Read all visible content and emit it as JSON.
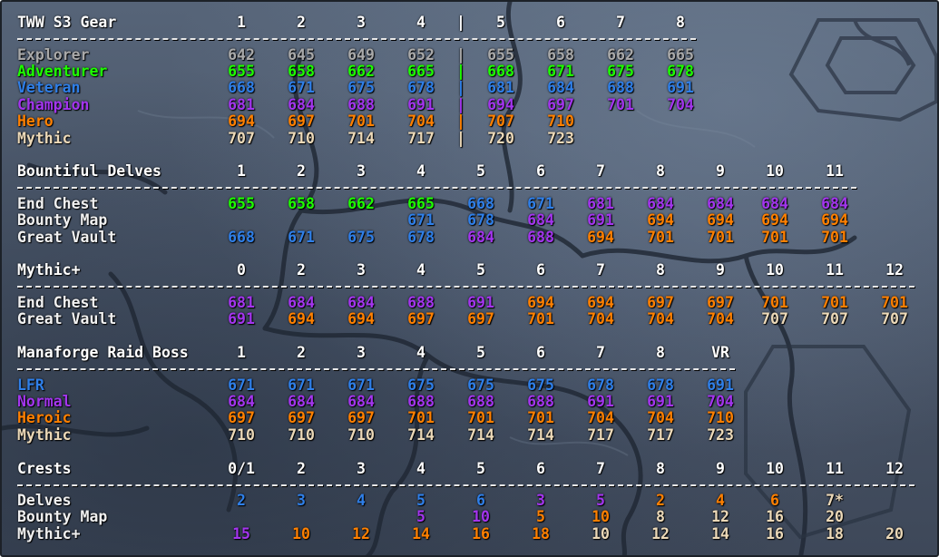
{
  "colors": {
    "explorer": "#a9a9a9",
    "adventurer": "#1eff00",
    "veteran": "#2f7fe8",
    "champion": "#a335ee",
    "hero": "#ff8000",
    "mythic": "#ecd9b8",
    "white": "#f0f0f0",
    "header": "#ffffff"
  },
  "sections": [
    {
      "id": "gear",
      "title": "TWW S3 Gear",
      "columns": [
        "1",
        "2",
        "3",
        "4",
        "|",
        "5",
        "6",
        "7",
        "8"
      ],
      "divider": "|",
      "rows": [
        {
          "label": "Explorer",
          "color": "explorer",
          "values": [
            "642",
            "645",
            "649",
            "652",
            "655",
            "658",
            "662",
            "665"
          ]
        },
        {
          "label": "Adventurer",
          "color": "adventurer",
          "values": [
            "655",
            "658",
            "662",
            "665",
            "668",
            "671",
            "675",
            "678"
          ]
        },
        {
          "label": "Veteran",
          "color": "veteran",
          "values": [
            "668",
            "671",
            "675",
            "678",
            "681",
            "684",
            "688",
            "691"
          ]
        },
        {
          "label": "Champion",
          "color": "champion",
          "values": [
            "681",
            "684",
            "688",
            "691",
            "694",
            "697",
            "701",
            "704"
          ]
        },
        {
          "label": "Hero",
          "color": "hero",
          "values": [
            "694",
            "697",
            "701",
            "704",
            "707",
            "710"
          ]
        },
        {
          "label": "Mythic",
          "color": "mythic",
          "values": [
            "707",
            "710",
            "714",
            "717",
            "720",
            "723"
          ]
        }
      ]
    },
    {
      "id": "delves",
      "title": "Bountiful Delves",
      "columns": [
        "1",
        "2",
        "3",
        "4",
        "5",
        "6",
        "7",
        "8",
        "9",
        "10",
        "11"
      ],
      "rows": [
        {
          "label": "End Chest",
          "cells": [
            {
              "v": "655",
              "c": "adventurer"
            },
            {
              "v": "658",
              "c": "adventurer"
            },
            {
              "v": "662",
              "c": "adventurer"
            },
            {
              "v": "665",
              "c": "adventurer"
            },
            {
              "v": "668",
              "c": "veteran"
            },
            {
              "v": "671",
              "c": "veteran"
            },
            {
              "v": "681",
              "c": "champion"
            },
            {
              "v": "684",
              "c": "champion"
            },
            {
              "v": "684",
              "c": "champion"
            },
            {
              "v": "684",
              "c": "champion"
            },
            {
              "v": "684",
              "c": "champion"
            }
          ]
        },
        {
          "label": "Bounty Map",
          "cells": [
            {
              "v": "",
              "c": "white"
            },
            {
              "v": "",
              "c": "white"
            },
            {
              "v": "",
              "c": "white"
            },
            {
              "v": "671",
              "c": "veteran"
            },
            {
              "v": "678",
              "c": "veteran"
            },
            {
              "v": "684",
              "c": "champion"
            },
            {
              "v": "691",
              "c": "champion"
            },
            {
              "v": "694",
              "c": "hero"
            },
            {
              "v": "694",
              "c": "hero"
            },
            {
              "v": "694",
              "c": "hero"
            },
            {
              "v": "694",
              "c": "hero"
            }
          ]
        },
        {
          "label": "Great Vault",
          "cells": [
            {
              "v": "668",
              "c": "veteran"
            },
            {
              "v": "671",
              "c": "veteran"
            },
            {
              "v": "675",
              "c": "veteran"
            },
            {
              "v": "678",
              "c": "veteran"
            },
            {
              "v": "684",
              "c": "champion"
            },
            {
              "v": "688",
              "c": "champion"
            },
            {
              "v": "694",
              "c": "hero"
            },
            {
              "v": "701",
              "c": "hero"
            },
            {
              "v": "701",
              "c": "hero"
            },
            {
              "v": "701",
              "c": "hero"
            },
            {
              "v": "701",
              "c": "hero"
            }
          ]
        }
      ]
    },
    {
      "id": "mythicplus",
      "title": "Mythic+",
      "columns": [
        "0",
        "2",
        "3",
        "4",
        "5",
        "6",
        "7",
        "8",
        "9",
        "10",
        "11",
        "12"
      ],
      "rows": [
        {
          "label": "End Chest",
          "cells": [
            {
              "v": "681",
              "c": "champion"
            },
            {
              "v": "684",
              "c": "champion"
            },
            {
              "v": "684",
              "c": "champion"
            },
            {
              "v": "688",
              "c": "champion"
            },
            {
              "v": "691",
              "c": "champion"
            },
            {
              "v": "694",
              "c": "hero"
            },
            {
              "v": "694",
              "c": "hero"
            },
            {
              "v": "697",
              "c": "hero"
            },
            {
              "v": "697",
              "c": "hero"
            },
            {
              "v": "701",
              "c": "hero"
            },
            {
              "v": "701",
              "c": "hero"
            },
            {
              "v": "701",
              "c": "hero"
            }
          ]
        },
        {
          "label": "Great Vault",
          "cells": [
            {
              "v": "691",
              "c": "champion"
            },
            {
              "v": "694",
              "c": "hero"
            },
            {
              "v": "694",
              "c": "hero"
            },
            {
              "v": "697",
              "c": "hero"
            },
            {
              "v": "697",
              "c": "hero"
            },
            {
              "v": "701",
              "c": "hero"
            },
            {
              "v": "704",
              "c": "hero"
            },
            {
              "v": "704",
              "c": "hero"
            },
            {
              "v": "704",
              "c": "hero"
            },
            {
              "v": "707",
              "c": "mythic"
            },
            {
              "v": "707",
              "c": "mythic"
            },
            {
              "v": "707",
              "c": "mythic"
            }
          ]
        }
      ]
    },
    {
      "id": "raid",
      "title": "Manaforge Raid Boss",
      "columns": [
        "1",
        "2",
        "3",
        "4",
        "5",
        "6",
        "7",
        "8",
        "VR"
      ],
      "rows": [
        {
          "label": "LFR",
          "labelColor": "veteran",
          "cells": [
            {
              "v": "671",
              "c": "veteran"
            },
            {
              "v": "671",
              "c": "veteran"
            },
            {
              "v": "671",
              "c": "veteran"
            },
            {
              "v": "675",
              "c": "veteran"
            },
            {
              "v": "675",
              "c": "veteran"
            },
            {
              "v": "675",
              "c": "veteran"
            },
            {
              "v": "678",
              "c": "veteran"
            },
            {
              "v": "678",
              "c": "veteran"
            },
            {
              "v": "691",
              "c": "veteran"
            }
          ]
        },
        {
          "label": "Normal",
          "labelColor": "champion",
          "cells": [
            {
              "v": "684",
              "c": "champion"
            },
            {
              "v": "684",
              "c": "champion"
            },
            {
              "v": "684",
              "c": "champion"
            },
            {
              "v": "688",
              "c": "champion"
            },
            {
              "v": "688",
              "c": "champion"
            },
            {
              "v": "688",
              "c": "champion"
            },
            {
              "v": "691",
              "c": "champion"
            },
            {
              "v": "691",
              "c": "champion"
            },
            {
              "v": "704",
              "c": "champion"
            }
          ]
        },
        {
          "label": "Heroic",
          "labelColor": "hero",
          "cells": [
            {
              "v": "697",
              "c": "hero"
            },
            {
              "v": "697",
              "c": "hero"
            },
            {
              "v": "697",
              "c": "hero"
            },
            {
              "v": "701",
              "c": "hero"
            },
            {
              "v": "701",
              "c": "hero"
            },
            {
              "v": "701",
              "c": "hero"
            },
            {
              "v": "704",
              "c": "hero"
            },
            {
              "v": "704",
              "c": "hero"
            },
            {
              "v": "710",
              "c": "hero"
            }
          ]
        },
        {
          "label": "Mythic",
          "labelColor": "mythic",
          "cells": [
            {
              "v": "710",
              "c": "mythic"
            },
            {
              "v": "710",
              "c": "mythic"
            },
            {
              "v": "710",
              "c": "mythic"
            },
            {
              "v": "714",
              "c": "mythic"
            },
            {
              "v": "714",
              "c": "mythic"
            },
            {
              "v": "714",
              "c": "mythic"
            },
            {
              "v": "717",
              "c": "mythic"
            },
            {
              "v": "717",
              "c": "mythic"
            },
            {
              "v": "723",
              "c": "mythic"
            }
          ]
        }
      ]
    },
    {
      "id": "crests",
      "title": "Crests",
      "columns": [
        "0/1",
        "2",
        "3",
        "4",
        "5",
        "6",
        "7",
        "8",
        "9",
        "10",
        "11",
        "12"
      ],
      "rows": [
        {
          "label": "Delves",
          "cells": [
            {
              "v": "2",
              "c": "veteran"
            },
            {
              "v": "3",
              "c": "veteran"
            },
            {
              "v": "4",
              "c": "veteran"
            },
            {
              "v": "5",
              "c": "veteran"
            },
            {
              "v": "6",
              "c": "veteran"
            },
            {
              "v": "3",
              "c": "champion"
            },
            {
              "v": "5",
              "c": "champion"
            },
            {
              "v": "2",
              "c": "hero"
            },
            {
              "v": "4",
              "c": "hero"
            },
            {
              "v": "6",
              "c": "hero"
            },
            {
              "v": "7*",
              "c": "mythic"
            },
            {
              "v": "",
              "c": "white"
            }
          ]
        },
        {
          "label": "Bounty Map",
          "cells": [
            {
              "v": "",
              "c": "white"
            },
            {
              "v": "",
              "c": "white"
            },
            {
              "v": "",
              "c": "white"
            },
            {
              "v": "5",
              "c": "champion"
            },
            {
              "v": "10",
              "c": "champion"
            },
            {
              "v": "5",
              "c": "hero"
            },
            {
              "v": "10",
              "c": "hero"
            },
            {
              "v": "8",
              "c": "mythic"
            },
            {
              "v": "12",
              "c": "mythic"
            },
            {
              "v": "16",
              "c": "mythic"
            },
            {
              "v": "20",
              "c": "mythic"
            },
            {
              "v": "",
              "c": "white"
            }
          ]
        },
        {
          "label": "Mythic+",
          "cells": [
            {
              "v": "15",
              "c": "champion"
            },
            {
              "v": "10",
              "c": "hero"
            },
            {
              "v": "12",
              "c": "hero"
            },
            {
              "v": "14",
              "c": "hero"
            },
            {
              "v": "16",
              "c": "hero"
            },
            {
              "v": "18",
              "c": "hero"
            },
            {
              "v": "10",
              "c": "mythic"
            },
            {
              "v": "12",
              "c": "mythic"
            },
            {
              "v": "14",
              "c": "mythic"
            },
            {
              "v": "16",
              "c": "mythic"
            },
            {
              "v": "18",
              "c": "mythic"
            },
            {
              "v": "20",
              "c": "mythic"
            }
          ]
        }
      ]
    }
  ]
}
